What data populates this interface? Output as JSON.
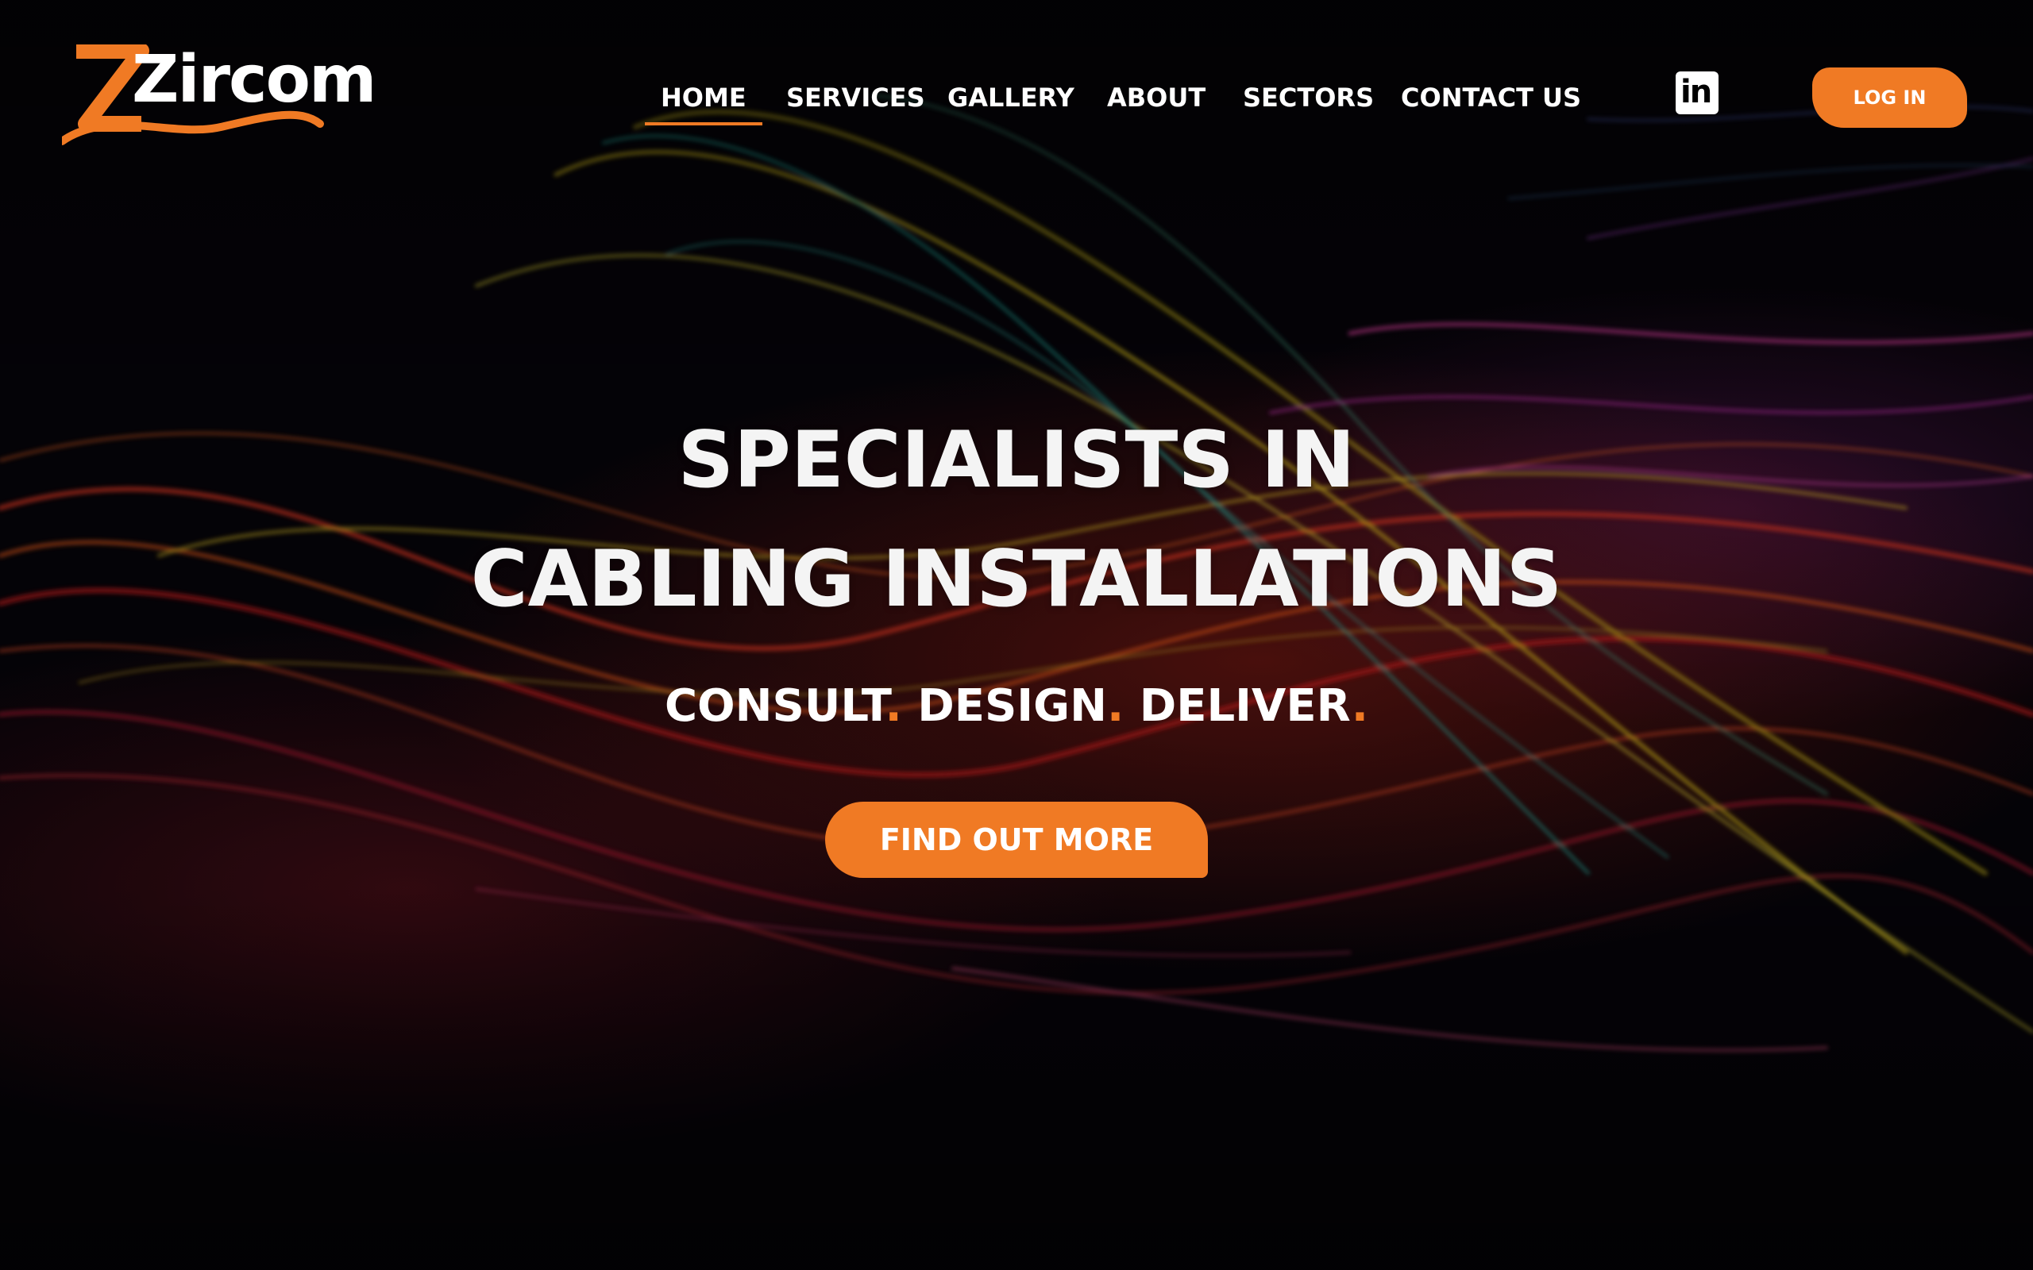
{
  "brand": {
    "name": "Zircom",
    "accent_color": "#f07a24"
  },
  "nav": {
    "items": [
      {
        "label": "HOME",
        "active": true
      },
      {
        "label": "SERVICES",
        "active": false
      },
      {
        "label": "GALLERY",
        "active": false
      },
      {
        "label": "ABOUT",
        "active": false
      },
      {
        "label": "SECTORS",
        "active": false
      },
      {
        "label": "CONTACT US",
        "active": false
      }
    ],
    "social_icon": "linkedin-icon",
    "social_label": "in",
    "login_label": "LOG IN"
  },
  "hero": {
    "title_line1": "SPECIALISTS IN",
    "title_line2": "CABLING INSTALLATIONS",
    "tagline": {
      "word1": "CONSULT",
      "word2": "DESIGN",
      "word3": "DELIVER",
      "separator": "."
    },
    "cta_label": "FIND OUT MORE",
    "background": "fiber-optic-light-strands"
  }
}
